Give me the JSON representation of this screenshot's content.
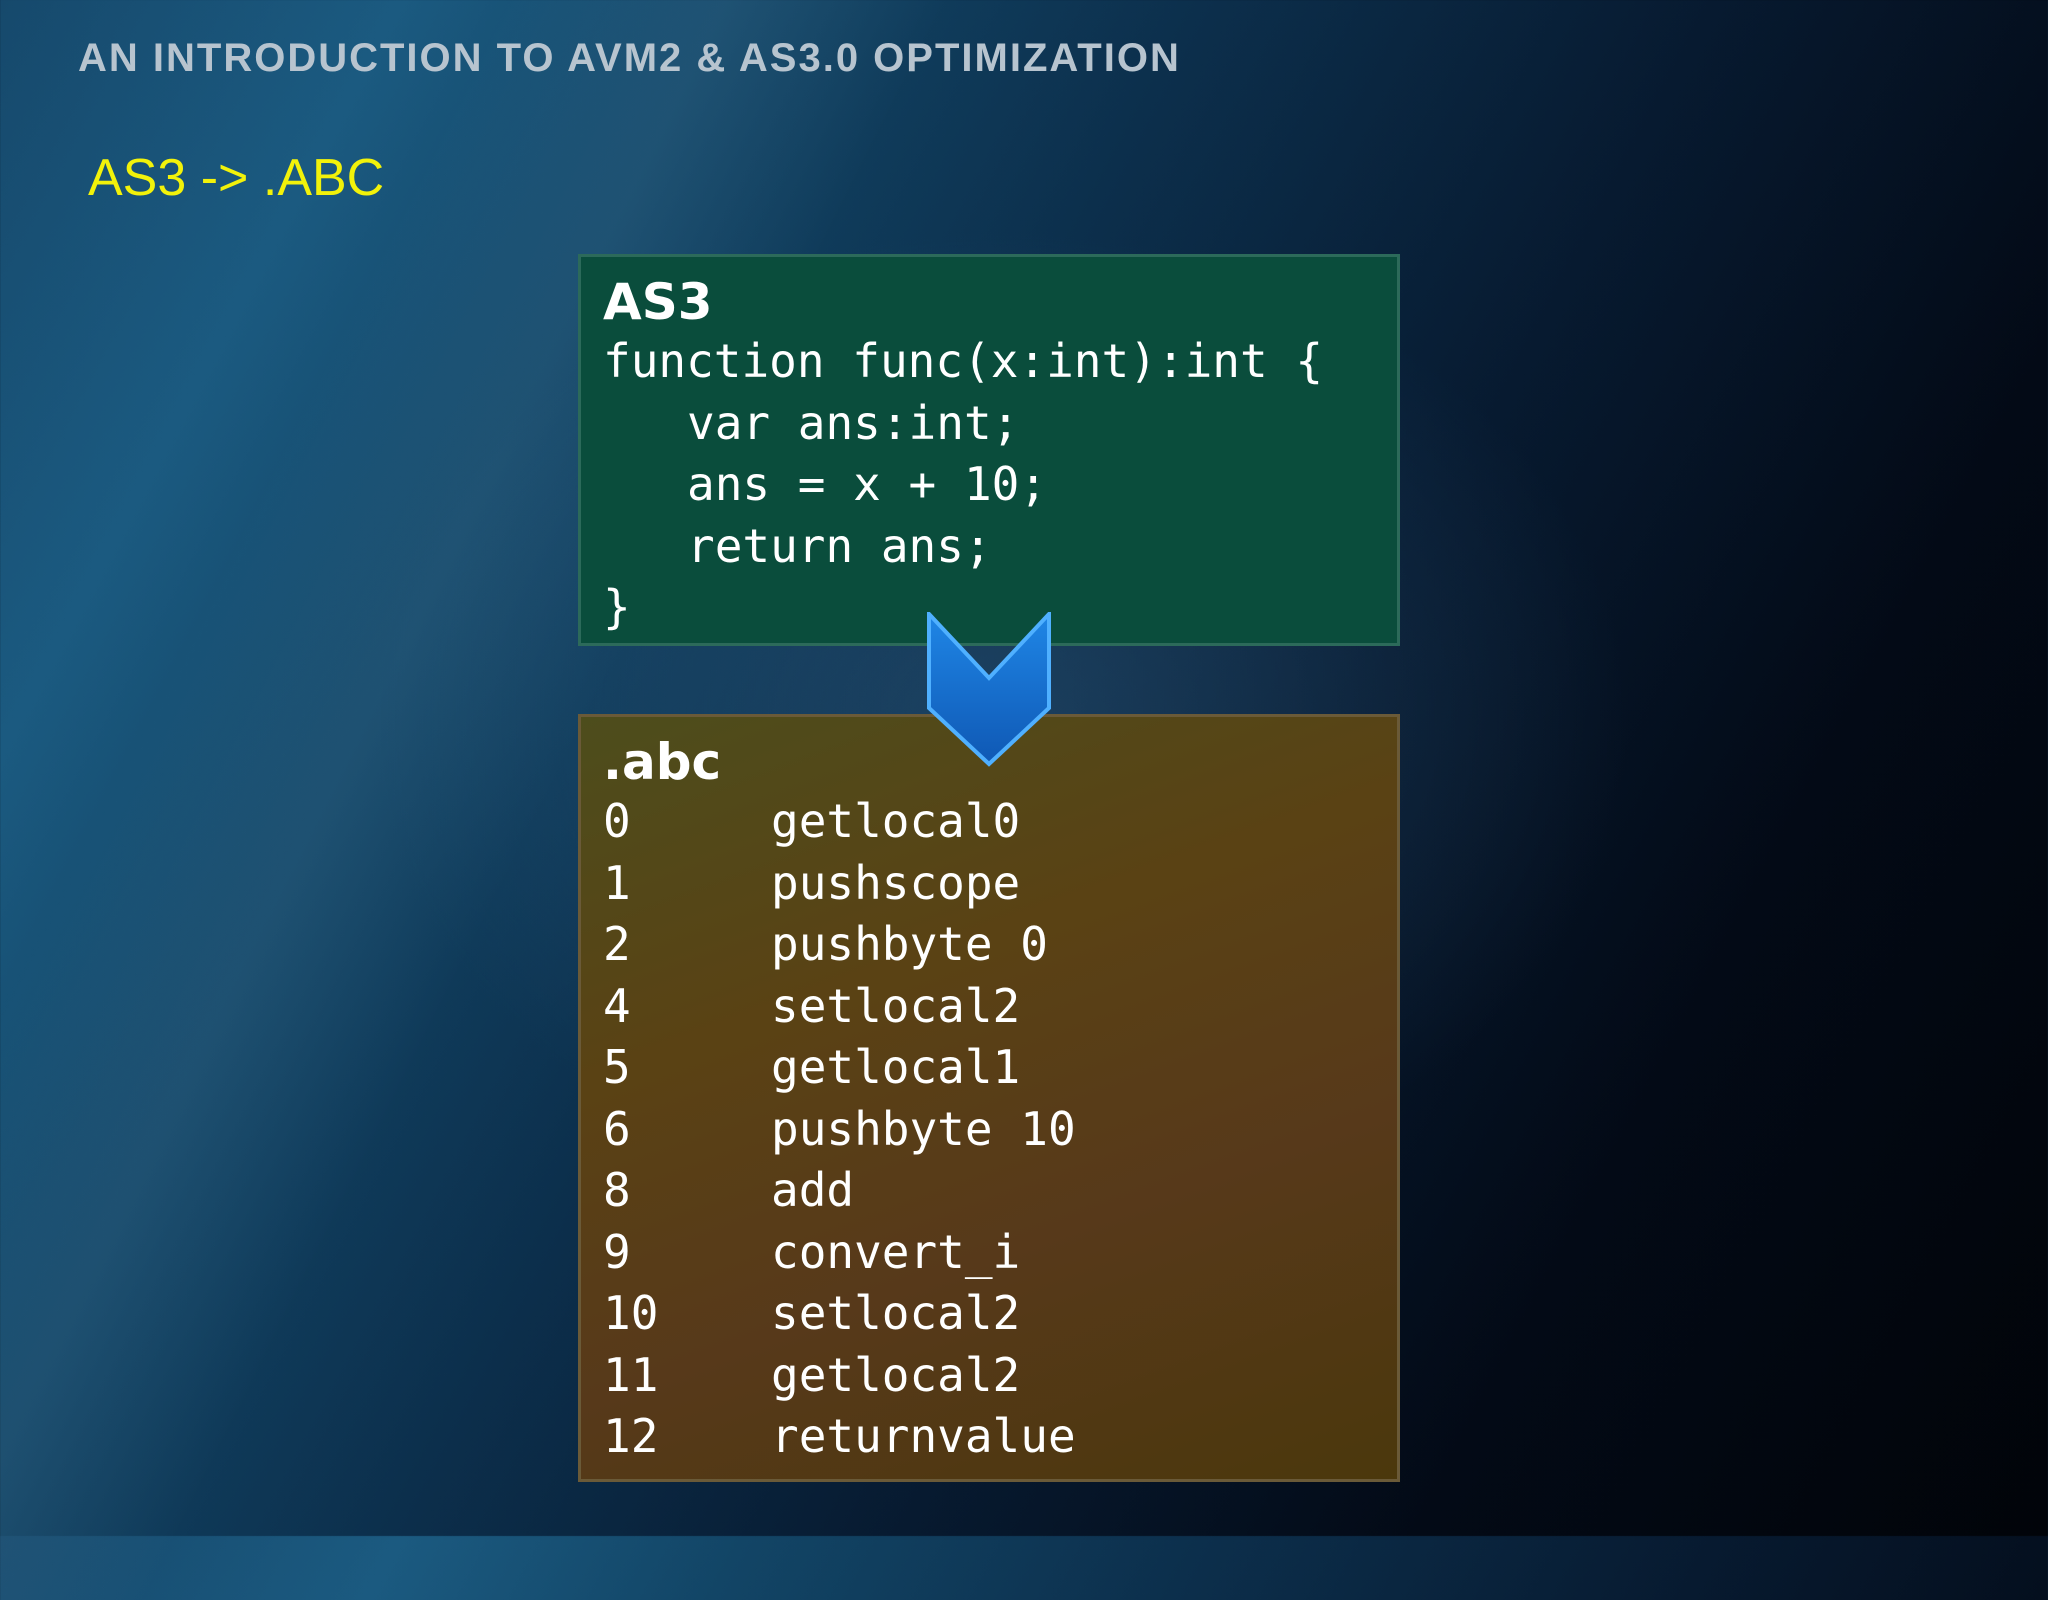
{
  "header": {
    "title": "AN INTRODUCTION TO AVM2 & AS3.0 OPTIMIZATION"
  },
  "slide": {
    "subtitle": "AS3 -> .ABC"
  },
  "as3_box": {
    "title": "AS3",
    "lines": [
      "function func(x:int):int {",
      "var ans:int;",
      "ans = x + 10;",
      "return ans;",
      "}"
    ]
  },
  "abc_box": {
    "title": ".abc",
    "rows": [
      {
        "offset": "0",
        "op": "getlocal0"
      },
      {
        "offset": "1",
        "op": "pushscope"
      },
      {
        "offset": "2",
        "op": "pushbyte 0"
      },
      {
        "offset": "4",
        "op": "setlocal2"
      },
      {
        "offset": "5",
        "op": "getlocal1"
      },
      {
        "offset": "6",
        "op": "pushbyte 10"
      },
      {
        "offset": "8",
        "op": "add"
      },
      {
        "offset": "9",
        "op": "convert_i"
      },
      {
        "offset": "10",
        "op": "setlocal2"
      },
      {
        "offset": "11",
        "op": "getlocal2"
      },
      {
        "offset": "12",
        "op": "returnvalue"
      }
    ]
  },
  "icons": {
    "arrow": "chevron-down-icon"
  },
  "colors": {
    "subtitle": "#f2f20a",
    "as3_box": "#0a4d3c",
    "abc_box": "#5a4214",
    "arrow": "#1b76d2"
  }
}
